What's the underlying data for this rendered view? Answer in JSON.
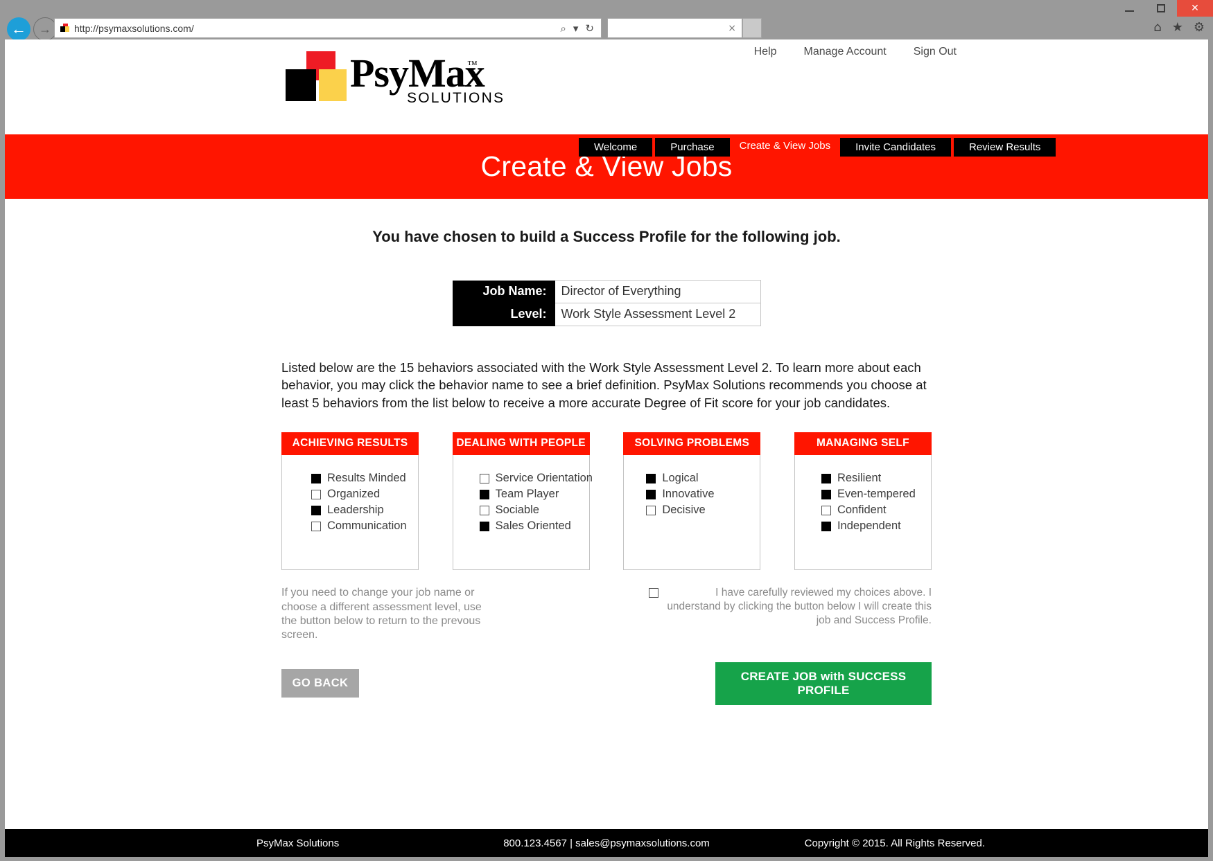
{
  "browser": {
    "url": "http://psymaxsolutions.com/",
    "search_value": "",
    "back_label": "←",
    "forward_label": "→",
    "search_icon": "⌕",
    "dropdown_icon": "▾",
    "refresh_icon": "↻",
    "clear_icon": "×",
    "home_icon": "⌂",
    "favorites_icon": "★",
    "settings_icon": "⚙",
    "minimize_label": "",
    "maximize_label": "",
    "close_label": "✕"
  },
  "site": {
    "util_nav": [
      {
        "label": "Help"
      },
      {
        "label": "Manage Account"
      },
      {
        "label": "Sign Out"
      }
    ],
    "logo": {
      "wordmark": "PsyMax",
      "trademark": "™",
      "subtitle": "SOLUTIONS"
    },
    "tabs": [
      {
        "label": "Welcome",
        "active": false
      },
      {
        "label": "Purchase",
        "active": false
      },
      {
        "label": "Create & View Jobs",
        "active": true
      },
      {
        "label": "Invite Candidates",
        "active": false
      },
      {
        "label": "Review Results",
        "active": false
      }
    ],
    "banner_title": "Create & View Jobs"
  },
  "page": {
    "lead": "You have chosen to build a Success Profile for the following job.",
    "job_info": [
      {
        "label": "Job Name:",
        "value": "Director of Everything"
      },
      {
        "label": "Level:",
        "value": "Work Style Assessment Level 2"
      }
    ],
    "instructions": "Listed below are the 15 behaviors associated with the Work Style Assessment Level 2. To learn more about each behavior, you may click the behavior name to see a brief definition. PsyMax Solutions recommends you choose at least 5 behaviors from the list below to receive a more accurate Degree of Fit score for your job candidates.",
    "categories": [
      {
        "title": "ACHIEVING RESULTS",
        "behaviors": [
          {
            "label": "Results Minded",
            "checked": true
          },
          {
            "label": "Organized",
            "checked": false
          },
          {
            "label": "Leadership",
            "checked": true
          },
          {
            "label": "Communication",
            "checked": false
          }
        ]
      },
      {
        "title": "DEALING WITH PEOPLE",
        "behaviors": [
          {
            "label": "Service Orientation",
            "checked": false
          },
          {
            "label": "Team Player",
            "checked": true
          },
          {
            "label": "Sociable",
            "checked": false
          },
          {
            "label": "Sales Oriented",
            "checked": true
          }
        ]
      },
      {
        "title": "SOLVING PROBLEMS",
        "behaviors": [
          {
            "label": "Logical",
            "checked": true
          },
          {
            "label": "Innovative",
            "checked": true
          },
          {
            "label": "Decisive",
            "checked": false
          }
        ]
      },
      {
        "title": "MANAGING SELF",
        "behaviors": [
          {
            "label": "Resilient",
            "checked": true
          },
          {
            "label": "Even-tempered",
            "checked": true
          },
          {
            "label": "Confident",
            "checked": false
          },
          {
            "label": "Independent",
            "checked": true
          }
        ]
      }
    ],
    "note_left": "If you need to change your job name or choose a different assessment level, use the button below to return to the prevous screen.",
    "confirm": {
      "checked": false,
      "text": "I have carefully reviewed my choices above. I understand by clicking the button below I will create this job and Success Profile."
    },
    "buttons": {
      "go_back": "GO BACK",
      "create": "CREATE JOB with SUCCESS PROFILE"
    }
  },
  "footer": {
    "left": "PsyMax Solutions",
    "middle": "800.123.4567 | sales@psymaxsolutions.com",
    "right": "Copyright © 2015. All Rights Reserved."
  }
}
